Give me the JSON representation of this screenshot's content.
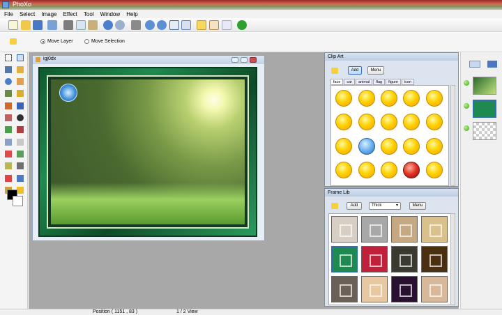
{
  "window": {
    "title": "PhoXo"
  },
  "menu": [
    "File",
    "Select",
    "Image",
    "Effect",
    "Tool",
    "Window",
    "Help"
  ],
  "options": {
    "move_layer": "Move Layer",
    "move_selection": "Move Selection",
    "selected": "Move Layer"
  },
  "image_window": {
    "title": "igj0dx"
  },
  "clip_art": {
    "title": "Clip Art",
    "add": "Add",
    "menu": "Menu",
    "tabs": [
      "face",
      "car",
      "animal",
      "flag",
      "figure",
      "icon"
    ],
    "active_tab": "face"
  },
  "frame_lib": {
    "title": "Frame Lib",
    "add": "Add",
    "category": "Thick",
    "menu": "Menu"
  },
  "status": {
    "position": "Position ( 1151 , 83 )",
    "view": "1 / 2 View"
  },
  "colors": {
    "accent": "#2f6fb0",
    "frame_green": "#1f8a50"
  }
}
